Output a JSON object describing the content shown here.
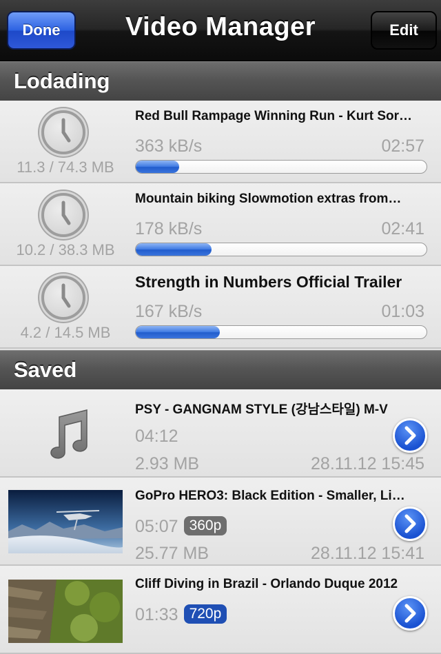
{
  "navbar": {
    "title": "Video Manager",
    "done_label": "Done",
    "edit_label": "Edit"
  },
  "sections": {
    "loading": "Lodading",
    "saved": "Saved"
  },
  "downloads": [
    {
      "title": "Red Bull Rampage Winning Run - Kurt Sor…",
      "speed": "363 kB/s",
      "eta": "02:57",
      "size": "11.3 / 74.3 MB",
      "progress": 0.15,
      "icon": "clock-icon"
    },
    {
      "title": "Mountain biking Slowmotion extras from…",
      "speed": "178 kB/s",
      "eta": "02:41",
      "size": "10.2 / 38.3 MB",
      "progress": 0.26,
      "icon": "clock-icon"
    },
    {
      "title": "Strength in Numbers Official Trailer",
      "speed": "167 kB/s",
      "eta": "01:03",
      "size": "4.2 / 14.5 MB",
      "progress": 0.29,
      "icon": "clock-icon"
    }
  ],
  "saved": [
    {
      "title": "PSY - GANGNAM STYLE (강남스타일) M-V",
      "duration": "04:12",
      "quality": "",
      "size": "2.93 MB",
      "date": "28.11.12 15:45",
      "icon": "music-note-icon"
    },
    {
      "title": "GoPro HERO3: Black Edition - Smaller, Li…",
      "duration": "05:07",
      "quality": "360p",
      "size": "25.77 MB",
      "date": "28.11.12 15:41",
      "icon": "video-thumbnail"
    },
    {
      "title": "Cliff Diving in Brazil - Orlando Duque 2012",
      "duration": "01:33",
      "quality": "720p",
      "size": "",
      "date": "",
      "icon": "video-thumbnail"
    }
  ],
  "colors": {
    "accent": "#2d62e2",
    "quality_360": "#6e6e6e",
    "quality_720": "#1f4fb4"
  }
}
